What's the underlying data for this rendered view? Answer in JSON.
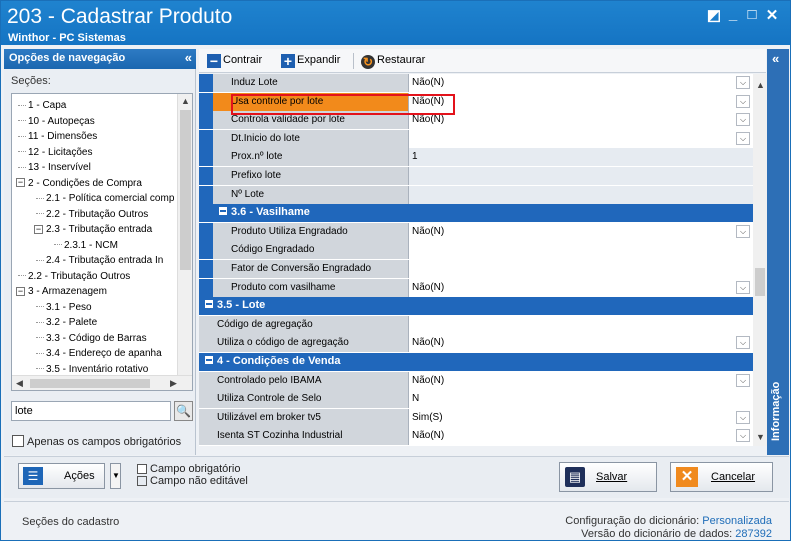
{
  "window": {
    "title": "203 - Cadastrar  Produto",
    "subtitle": "Winthor - PC Sistemas",
    "controls": [
      "◩",
      "_",
      "□",
      "✕"
    ]
  },
  "nav": {
    "header": "Opções de navegação",
    "collapse": "«",
    "sections_label": "Seções:",
    "tree": [
      {
        "label": "1 - Capa",
        "level": 0
      },
      {
        "label": "10 - Autopeças",
        "level": 0
      },
      {
        "label": "11 - Dimensões",
        "level": 0
      },
      {
        "label": "12 - Licitações",
        "level": 0
      },
      {
        "label": "13 - Inservível",
        "level": 0
      },
      {
        "label": "2 - Condições de Compra",
        "level": 0,
        "expander": "−"
      },
      {
        "label": "2.1 - Política comercial comp",
        "level": 1
      },
      {
        "label": "2.2 - Tributação Outros",
        "level": 1
      },
      {
        "label": "2.3 - Tributação entrada",
        "level": 1,
        "expander": "−"
      },
      {
        "label": "2.3.1 - NCM",
        "level": 2
      },
      {
        "label": "2.4 - Tributação entrada In",
        "level": 1
      },
      {
        "label": "2.2 - Tributação Outros",
        "level": 0
      },
      {
        "label": "3 - Armazenagem",
        "level": 0,
        "expander": "−"
      },
      {
        "label": "3.1 - Peso",
        "level": 1
      },
      {
        "label": "3.2 - Palete",
        "level": 1
      },
      {
        "label": "3.3 - Código de Barras",
        "level": 1
      },
      {
        "label": "3.4 - Endereço de apanha",
        "level": 1
      },
      {
        "label": "3.5 - Inventário rotativo",
        "level": 1
      }
    ],
    "search_value": "lote",
    "required_only_label": "Apenas os campos obrigatórios"
  },
  "toolbar": {
    "contrair": "Contrair",
    "expandir": "Expandir",
    "restaurar": "Restaurar"
  },
  "grid": {
    "rows": [
      {
        "type": "field",
        "label": "Induz Lote",
        "value": "Não(N)",
        "dropdown": true
      },
      {
        "type": "field",
        "label": "Usa controle por lote",
        "value": "Não(N)",
        "dropdown": true,
        "highlight": true
      },
      {
        "type": "field",
        "label": "Controla validade por lote",
        "value": "Não(N)",
        "dropdown": true
      },
      {
        "type": "field",
        "label": "Dt.Inicio do lote",
        "value": "",
        "dropdown": true
      },
      {
        "type": "field",
        "label": "Prox.nº lote",
        "value": "1",
        "readonly": true
      },
      {
        "type": "field",
        "label": "Prefixo lote",
        "value": "",
        "readonly": true
      },
      {
        "type": "field",
        "label": "Nº Lote",
        "value": "",
        "readonly": true
      },
      {
        "type": "section",
        "label": "3.6 - Vasilhame",
        "level": 1
      },
      {
        "type": "field",
        "label": "Produto Utiliza Engradado",
        "value": "Não(N)",
        "dropdown": true
      },
      {
        "type": "field",
        "label": "Código Engradado",
        "value": ""
      },
      {
        "type": "field",
        "label": "Fator de Conversão Engradado",
        "value": ""
      },
      {
        "type": "field",
        "label": "Produto com vasilhame",
        "value": "Não(N)",
        "dropdown": true
      },
      {
        "type": "section",
        "label": "3.5 - Lote",
        "level": 0
      },
      {
        "type": "field",
        "label": "Código de agregação",
        "value": "",
        "level": 0
      },
      {
        "type": "field",
        "label": "Utiliza o código de agregação",
        "value": "Não(N)",
        "dropdown": true,
        "level": 0
      },
      {
        "type": "section",
        "label": "4 - Condições de Venda",
        "level": 0
      },
      {
        "type": "field",
        "label": "Controlado pelo IBAMA",
        "value": "Não(N)",
        "dropdown": true,
        "level": 0
      },
      {
        "type": "field",
        "label": "Utiliza Controle de Selo",
        "value": "N",
        "level": 0
      },
      {
        "type": "field",
        "label": "Utilizável em broker tv5",
        "value": "Sim(S)",
        "dropdown": true,
        "level": 0
      },
      {
        "type": "field",
        "label": "Isenta ST Cozinha Industrial",
        "value": "Não(N)",
        "dropdown": true,
        "level": 0
      }
    ]
  },
  "info_tab": {
    "label": "Informação",
    "collapse": "«"
  },
  "bottom": {
    "acoes": "Ações",
    "legend_required": "Campo obrigatório",
    "legend_readonly": "Campo não editável",
    "salvar": "Salvar",
    "cancelar": "Cancelar"
  },
  "status": {
    "left": "Seções do cadastro",
    "config_label": "Configuração do dicionário:",
    "config_value": "Personalizada",
    "version_label": "Versão do dicionário de dados:",
    "version_value": "287392"
  },
  "colors": {
    "titlebar": "#1a77c8",
    "section": "#2067bb",
    "highlight_label": "#f28a1b",
    "highlight_border": "#e3121b"
  }
}
